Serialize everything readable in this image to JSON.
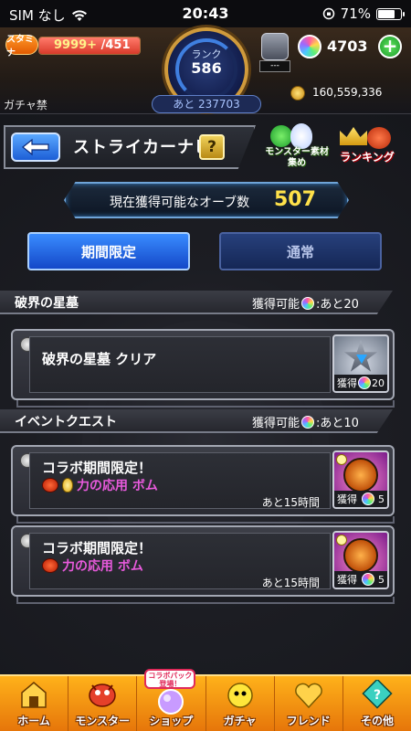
{
  "status_bar": {
    "carrier": "SIM なし",
    "time": "20:43",
    "battery": "71%"
  },
  "header": {
    "stamina_label": "スタミナ",
    "stamina_value": "9999+",
    "stamina_max": "/451",
    "stamina_fraction": 1.0,
    "rank_label": "ランク",
    "rank_value": "586",
    "rank_next": "あと 237703",
    "box_count": "---",
    "orb_count": "4703",
    "plus_label": "+",
    "gacha_ban": "ガチャ禁",
    "coins": "160,559,336"
  },
  "title_bar": {
    "back_icon": "arrow-left-icon",
    "title": "ストライカーナビ",
    "help_label": "?",
    "monster_material_label": "モンスター素材集め",
    "ranking_label": "ランキング"
  },
  "orb_banner": {
    "label": "現在獲得可能なオーブ数",
    "count": "507"
  },
  "tabs": [
    {
      "label": "期間限定",
      "active": true
    },
    {
      "label": "通常",
      "active": false
    }
  ],
  "sections": [
    {
      "title": "破界の星墓",
      "available_label": "獲得可能",
      "available_suffix": ":あと20",
      "quests": [
        {
          "title": "破界の星墓 クリア",
          "reward_label": "獲得",
          "reward_count": "20"
        }
      ]
    },
    {
      "title": "イベントクエスト",
      "available_label": "獲得可能",
      "available_suffix": ":あと10",
      "quests": [
        {
          "title": "コラボ期間限定！",
          "subtitle": "力の応用 ボム",
          "time_left": "あと15時間",
          "reward_label": "獲得",
          "reward_count": "5"
        },
        {
          "title": "コラボ期間限定！",
          "subtitle": "力の応用 ボム",
          "time_left": "あと15時間",
          "reward_label": "獲得",
          "reward_count": "5"
        }
      ]
    }
  ],
  "bottom_nav": [
    {
      "label": "ホーム",
      "icon": "home-icon"
    },
    {
      "label": "モンスター",
      "icon": "monster-icon"
    },
    {
      "label": "ショップ",
      "icon": "shop-icon",
      "badge": "コラボパック登場！"
    },
    {
      "label": "ガチャ",
      "icon": "gacha-icon"
    },
    {
      "label": "フレンド",
      "icon": "friend-icon"
    },
    {
      "label": "その他",
      "icon": "other-icon"
    }
  ],
  "colors": {
    "accent_blue": "#1c5ed6",
    "orb_gold": "#ffe14a",
    "nav_orange": "#f28e12",
    "quest_pink": "#e85adc"
  }
}
